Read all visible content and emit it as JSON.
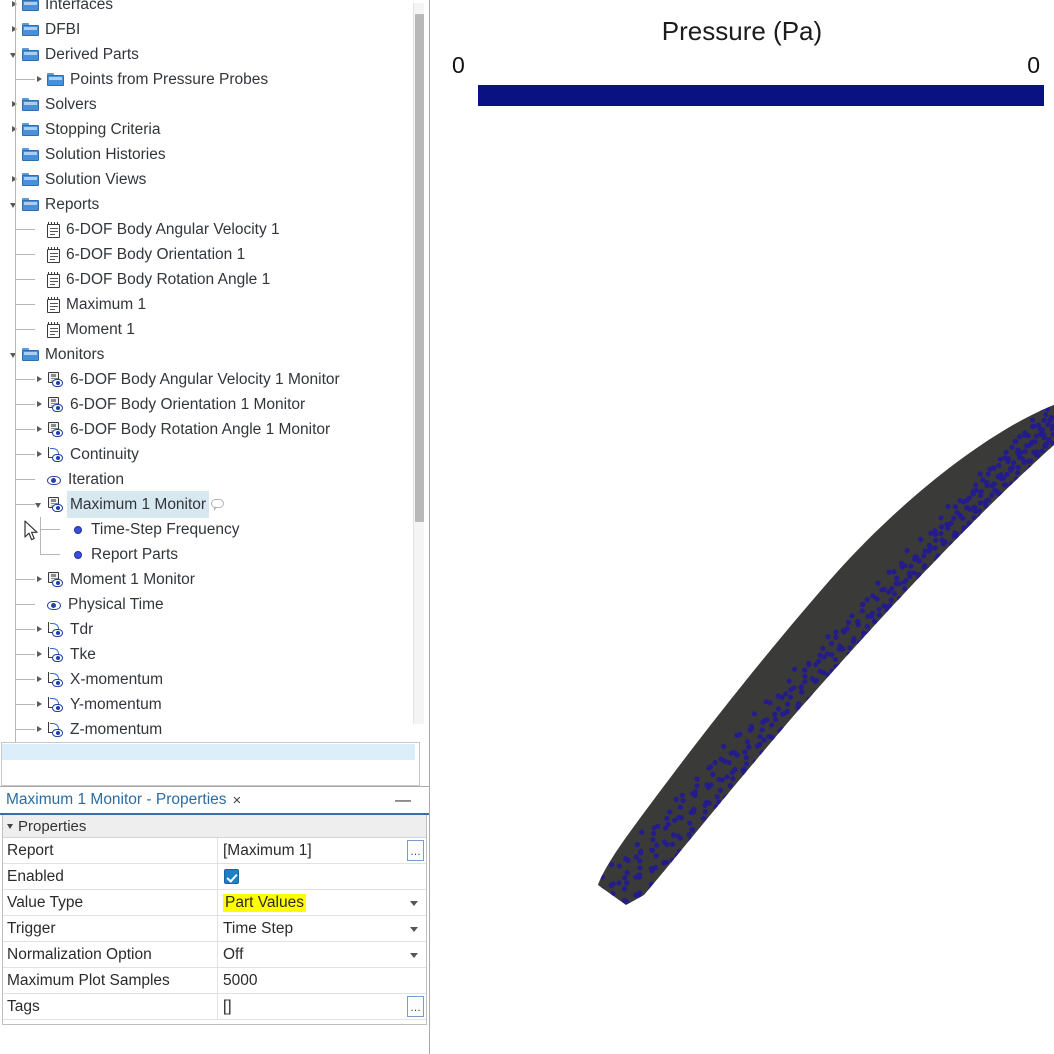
{
  "tree": {
    "panel_name": "simulation-object-tree",
    "items": [
      {
        "label": "Interfaces",
        "indent": 0,
        "expander": "closed",
        "icon": "folder-icon"
      },
      {
        "label": "DFBI",
        "indent": 0,
        "expander": "closed",
        "icon": "folder-icon"
      },
      {
        "label": "Derived Parts",
        "indent": 0,
        "expander": "open",
        "icon": "folder-icon"
      },
      {
        "label": "Points from Pressure Probes",
        "indent": 1,
        "expander": "closed",
        "icon": "folder-icon"
      },
      {
        "label": "Solvers",
        "indent": 0,
        "expander": "closed",
        "icon": "folder-icon"
      },
      {
        "label": "Stopping Criteria",
        "indent": 0,
        "expander": "closed",
        "icon": "folder-icon"
      },
      {
        "label": "Solution Histories",
        "indent": 0,
        "expander": "none",
        "icon": "folder-icon"
      },
      {
        "label": "Solution Views",
        "indent": 0,
        "expander": "closed",
        "icon": "folder-icon"
      },
      {
        "label": "Reports",
        "indent": 0,
        "expander": "open",
        "icon": "folder-icon"
      },
      {
        "label": "6-DOF Body Angular Velocity 1",
        "indent": 1,
        "expander": "none",
        "icon": "report-icon"
      },
      {
        "label": "6-DOF Body Orientation 1",
        "indent": 1,
        "expander": "none",
        "icon": "report-icon"
      },
      {
        "label": "6-DOF Body Rotation Angle 1",
        "indent": 1,
        "expander": "none",
        "icon": "report-icon"
      },
      {
        "label": "Maximum 1",
        "indent": 1,
        "expander": "none",
        "icon": "report-icon"
      },
      {
        "label": "Moment 1",
        "indent": 1,
        "expander": "none",
        "icon": "report-icon"
      },
      {
        "label": "Monitors",
        "indent": 0,
        "expander": "open",
        "icon": "folder-icon"
      },
      {
        "label": "6-DOF Body Angular Velocity 1 Monitor",
        "indent": 1,
        "expander": "closed",
        "icon": "monitor-icon"
      },
      {
        "label": "6-DOF Body Orientation 1 Monitor",
        "indent": 1,
        "expander": "closed",
        "icon": "monitor-icon"
      },
      {
        "label": "6-DOF Body Rotation Angle 1 Monitor",
        "indent": 1,
        "expander": "closed",
        "icon": "monitor-icon"
      },
      {
        "label": "Continuity",
        "indent": 1,
        "expander": "closed",
        "icon": "residual-monitor-icon"
      },
      {
        "label": "Iteration",
        "indent": 1,
        "expander": "none",
        "icon": "eye-icon"
      },
      {
        "label": "Maximum 1 Monitor",
        "indent": 1,
        "expander": "open",
        "icon": "monitor-icon",
        "selected": true,
        "badge": "comment-bubble-icon"
      },
      {
        "label": "Time-Step Frequency",
        "indent": 2,
        "expander": "none",
        "icon": "property-dot-icon"
      },
      {
        "label": "Report Parts",
        "indent": 2,
        "expander": "none",
        "icon": "property-dot-icon"
      },
      {
        "label": "Moment 1 Monitor",
        "indent": 1,
        "expander": "closed",
        "icon": "monitor-icon"
      },
      {
        "label": "Physical Time",
        "indent": 1,
        "expander": "none",
        "icon": "eye-icon"
      },
      {
        "label": "Tdr",
        "indent": 1,
        "expander": "closed",
        "icon": "residual-monitor-icon"
      },
      {
        "label": "Tke",
        "indent": 1,
        "expander": "closed",
        "icon": "residual-monitor-icon"
      },
      {
        "label": "X-momentum",
        "indent": 1,
        "expander": "closed",
        "icon": "residual-monitor-icon"
      },
      {
        "label": "Y-momentum",
        "indent": 1,
        "expander": "closed",
        "icon": "residual-monitor-icon"
      },
      {
        "label": "Z-momentum",
        "indent": 1,
        "expander": "closed",
        "icon": "residual-monitor-icon"
      }
    ]
  },
  "properties": {
    "title": "Maximum 1 Monitor - Properties",
    "close_label": "×",
    "minimize_label": "—",
    "group_label": "Properties",
    "rows": [
      {
        "name": "Report",
        "value": "[Maximum 1]",
        "control": "ellipsis",
        "highlight": false
      },
      {
        "name": "Enabled",
        "value": "",
        "control": "checkbox",
        "highlight": false
      },
      {
        "name": "Value Type",
        "value": "Part Values",
        "control": "dropdown",
        "highlight": true
      },
      {
        "name": "Trigger",
        "value": "Time Step",
        "control": "dropdown",
        "highlight": false
      },
      {
        "name": "Normalization Option",
        "value": "Off",
        "control": "dropdown",
        "highlight": false
      },
      {
        "name": "Maximum Plot Samples",
        "value": "5000",
        "control": "text",
        "highlight": false
      },
      {
        "name": "Tags",
        "value": "[]",
        "control": "ellipsis",
        "highlight": false
      }
    ],
    "ellipsis_label": "…"
  },
  "scene": {
    "scalar_title": "Pressure (Pa)",
    "scalar_min": "0",
    "scalar_max": "0",
    "scalar_bar_color": "#0a1182",
    "surface_color": "#3a3a38",
    "probe_point_color": "#241b8c",
    "background": "#ffffff"
  }
}
